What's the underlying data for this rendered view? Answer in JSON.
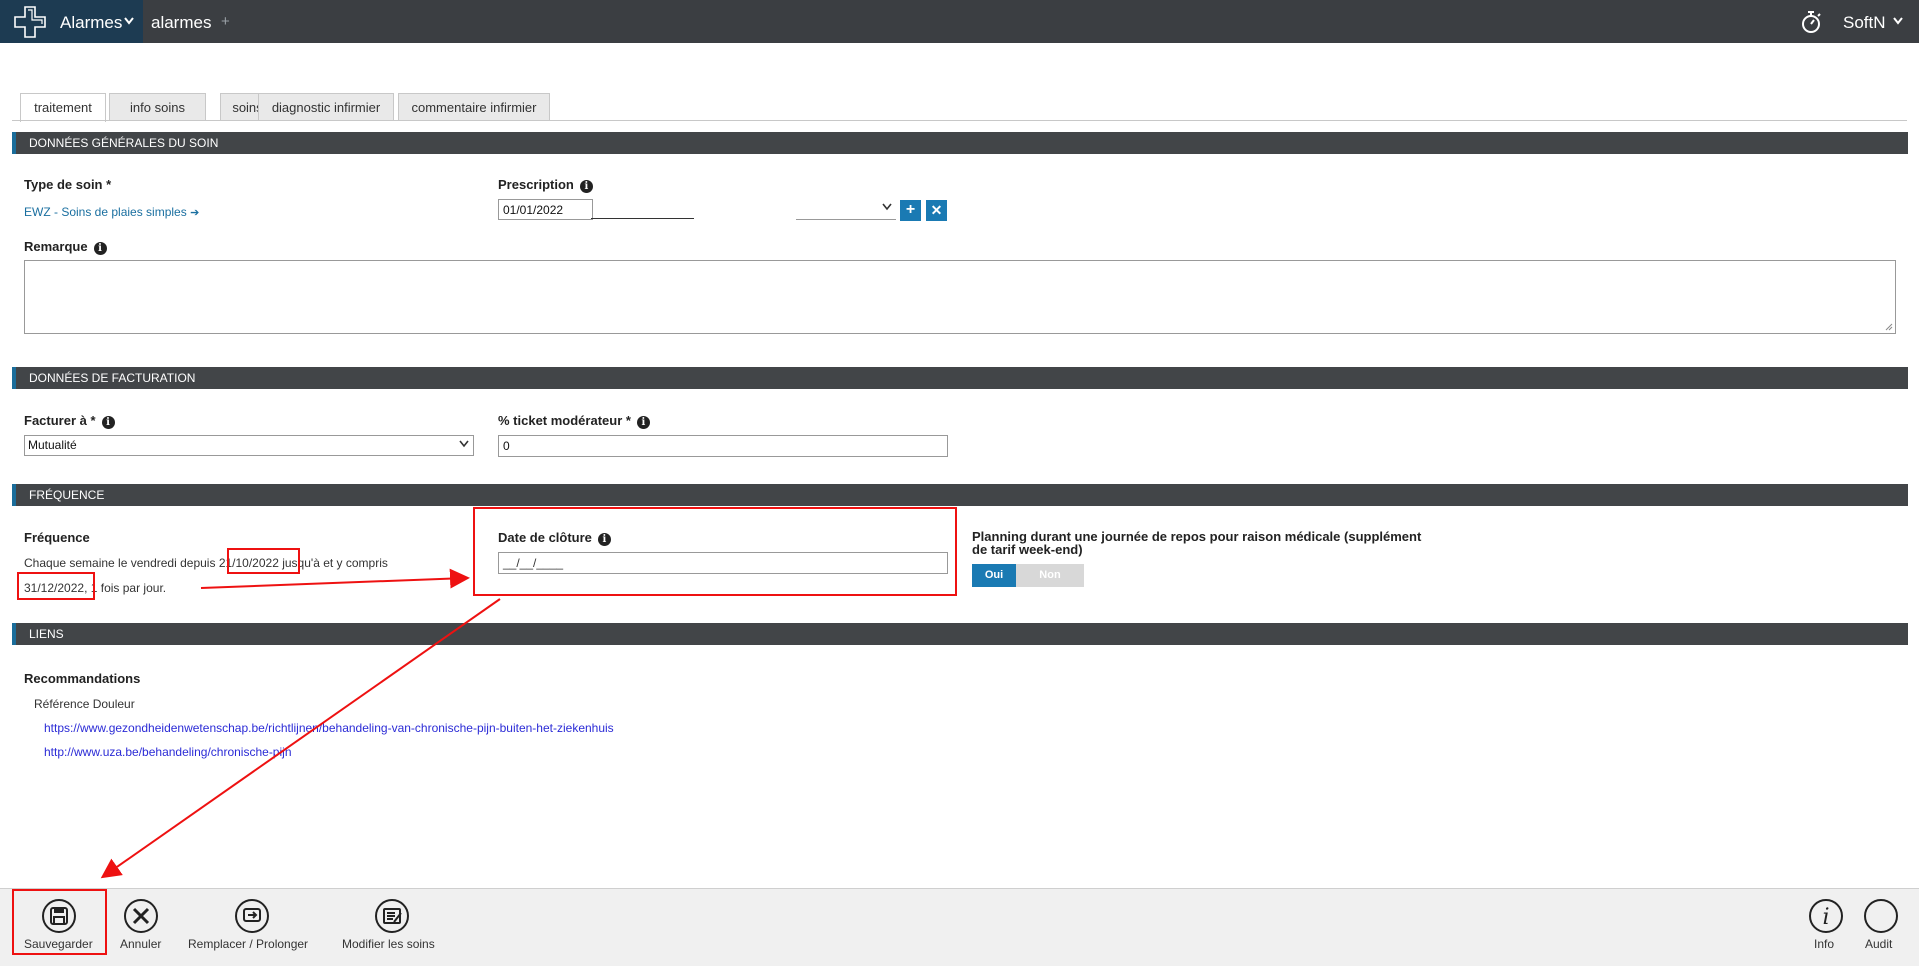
{
  "header": {
    "app_name": "Alarmes",
    "tab_label": "alarmes",
    "add_tab": "+",
    "user_name": "SoftN"
  },
  "tabs": [
    {
      "label": "traitement",
      "active": true
    },
    {
      "label": "info soins",
      "active": false
    },
    {
      "label": "soins",
      "active": false
    },
    {
      "label": "diagnostic infirmier",
      "active": false
    },
    {
      "label": "commentaire infirmier",
      "active": false
    }
  ],
  "general": {
    "section_title": "DONNÉES GÉNÉRALES DU SOIN",
    "type_label": "Type de soin *",
    "type_value": "EWZ - Soins de plaies simples",
    "type_arrow": "➔",
    "prescription_label": "Prescription",
    "prescription_date": "01/01/2022",
    "prescription_plus": "+",
    "prescription_clear": "✕",
    "remark_label": "Remarque"
  },
  "billing": {
    "section_title": "DONNÉES DE FACTURATION",
    "bill_to_label": "Facturer à *",
    "bill_to_value": "Mutualité",
    "ticket_label": "% ticket modérateur *",
    "ticket_value": "0"
  },
  "frequency": {
    "section_title": "FRÉQUENCE",
    "label": "Fréquence",
    "text_part1": "Chaque semaine le vendredi depuis",
    "start_date": "21/10/2022",
    "text_part2": "jusqu'à et y compris",
    "end_date": "31/12/2022",
    "text_part3": ", 1 fois par jour.",
    "closing_label": "Date de clôture",
    "closing_placeholder": "__/__/____",
    "planning_label": "Planning durant une journée de repos pour raison médicale (supplément de tarif week-end)",
    "toggle_on": "Oui",
    "toggle_off": "Non",
    "toggle_value": "Oui"
  },
  "links": {
    "section_title": "LIENS",
    "reco_label": "Recommandations",
    "reference_label": "Référence Douleur",
    "url1": "https://www.gezondheidenwetenschap.be/richtlijnen/behandeling-van-chronische-pijn-buiten-het-ziekenhuis",
    "url2": "http://www.uza.be/behandeling/chronische-pijn"
  },
  "toolbar": {
    "save": "Sauvegarder",
    "cancel": "Annuler",
    "replace": "Remplacer / Prolonger",
    "modify": "Modifier les soins",
    "info": "Info",
    "audit": "Audit"
  },
  "icons": {
    "logo": "cross-logo-icon",
    "timer": "stopwatch-icon",
    "save": "floppy-disk-icon",
    "cancel": "x-circle-icon",
    "replace": "replace-icon",
    "modify": "edit-list-icon",
    "info": "info-circle-icon",
    "audit": "circle-icon"
  },
  "colors": {
    "topbar": "#3b3e42",
    "app_button": "#1d3b52",
    "accent": "#1a7ab3",
    "annotation": "#e11111"
  }
}
